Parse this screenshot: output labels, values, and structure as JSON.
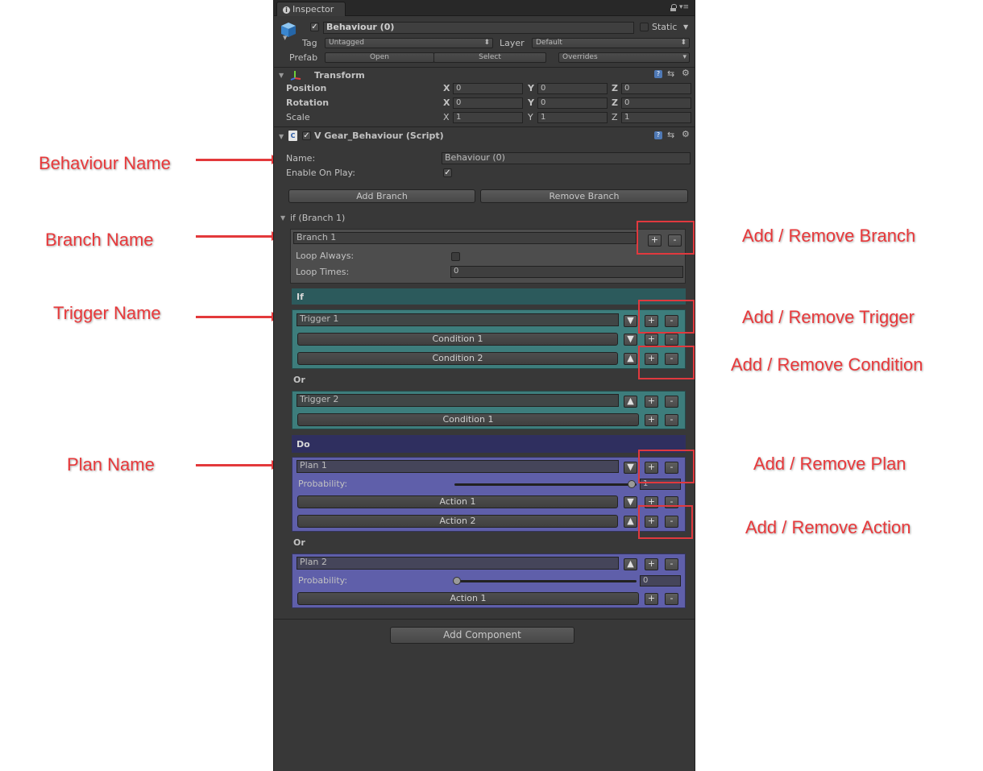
{
  "tab": {
    "title": "Inspector"
  },
  "gameobject": {
    "name": "Behaviour (0)",
    "static_label": "Static",
    "tag_label": "Tag",
    "tag_value": "Untagged",
    "layer_label": "Layer",
    "layer_value": "Default",
    "prefab_label": "Prefab",
    "open_label": "Open",
    "select_label": "Select",
    "overrides_label": "Overrides"
  },
  "transform": {
    "title": "Transform",
    "position_label": "Position",
    "rotation_label": "Rotation",
    "scale_label": "Scale",
    "axes": [
      "X",
      "Y",
      "Z"
    ],
    "position": [
      "0",
      "0",
      "0"
    ],
    "rotation": [
      "0",
      "0",
      "0"
    ],
    "scale": [
      "1",
      "1",
      "1"
    ]
  },
  "script": {
    "title": "V Gear_Behaviour (Script)",
    "name_label": "Name:",
    "name_value": "Behaviour (0)",
    "enable_label": "Enable On Play:",
    "add_branch_label": "Add Branch",
    "remove_branch_label": "Remove Branch",
    "branch_fold_label": "if (Branch 1)",
    "branch_name": "Branch 1",
    "loop_always_label": "Loop Always:",
    "loop_times_label": "Loop Times:",
    "loop_times_value": "0",
    "if_label": "If",
    "or_label": "Or",
    "do_label": "Do",
    "trigger1": "Trigger 1",
    "condition1": "Condition 1",
    "condition2": "Condition 2",
    "trigger2": "Trigger 2",
    "trigger2_condition1": "Condition 1",
    "plan1": "Plan 1",
    "probability_label": "Probability:",
    "plan1_probability": "1",
    "action1": "Action 1",
    "action2": "Action 2",
    "plan2": "Plan 2",
    "plan2_probability": "0",
    "plan2_action1": "Action 1",
    "plus": "+",
    "minus": "-",
    "down": "▼",
    "up": "▲"
  },
  "add_component_label": "Add Component",
  "annotations": {
    "behaviour_name": "Behaviour Name",
    "branch_name": "Branch Name",
    "trigger_name": "Trigger Name",
    "plan_name": "Plan Name",
    "add_remove_branch": "Add / Remove Branch",
    "add_remove_trigger": "Add / Remove Trigger",
    "add_remove_condition": "Add / Remove Condition",
    "add_remove_plan": "Add / Remove Plan",
    "add_remove_action": "Add / Remove Action"
  },
  "colors": {
    "annotation_red": "#e8393b",
    "if_teal": "#3d7d7c",
    "do_purple": "#5f5faa",
    "panel_bg": "#383838"
  }
}
